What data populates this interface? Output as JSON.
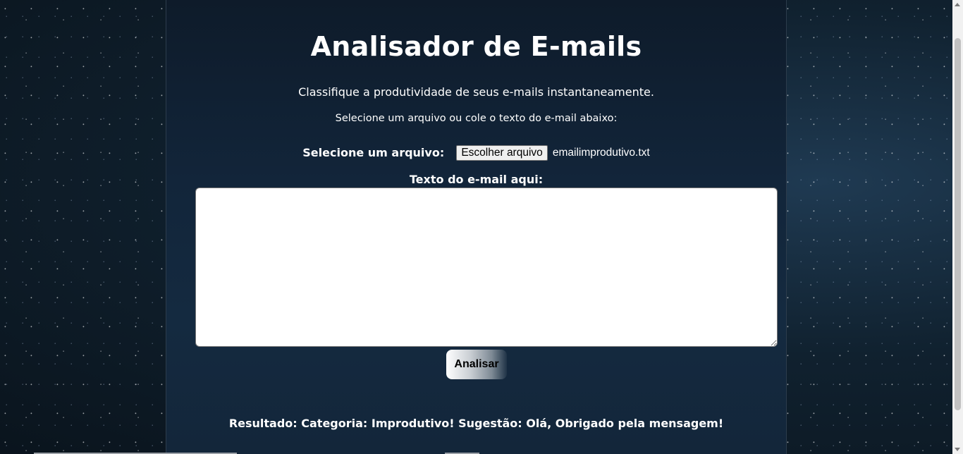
{
  "header": {
    "title": "Analisador de E-mails",
    "subtitle": "Classifique a produtividade de seus e-mails instantaneamente.",
    "instruction": "Selecione um arquivo ou cole o texto do e-mail abaixo:"
  },
  "file_input": {
    "label": "Selecione um arquivo:",
    "button_label": "Escolher arquivo",
    "selected_file": "emailimprodutivo.txt"
  },
  "email_text": {
    "label": "Texto do e-mail aqui:",
    "value": ""
  },
  "actions": {
    "analyze_label": "Analisar"
  },
  "result": {
    "text": "Resultado: Categoria: Improdutivo! Sugestão: Olá, Obrigado pela mensagem!"
  },
  "colors": {
    "panel": "#12253a",
    "text": "#ffffff",
    "background": "#0b1620"
  }
}
